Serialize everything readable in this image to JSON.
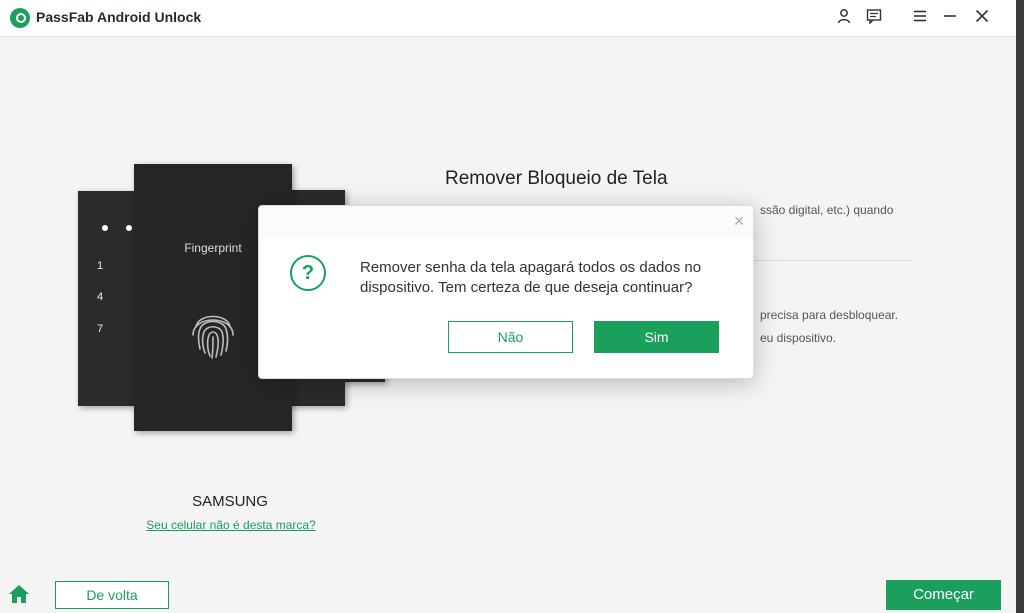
{
  "app": {
    "title": "PassFab Android Unlock"
  },
  "titlebar": {
    "icons": [
      "user-icon",
      "feedback-icon",
      "menu-icon",
      "minimize-icon",
      "close-icon"
    ]
  },
  "phone": {
    "fingerprint_label": "Fingerprint",
    "pin_numbers": [
      "1",
      "4",
      "7"
    ]
  },
  "brand": {
    "name": "SAMSUNG",
    "wrong_brand_link": "Seu celular não é desta marca?"
  },
  "section": {
    "title": "Remover Bloqueio de Tela",
    "desc1_visible": "ssão digital, etc.) quando",
    "desc2_visible": "precisa para desbloquear.",
    "desc3_visible": "eu dispositivo."
  },
  "bottom": {
    "back_label": "De volta",
    "start_label": "Começar"
  },
  "dialog": {
    "message": "Remover senha da tela apagará todos os dados no dispositivo. Tem certeza de que deseja continuar?",
    "question_glyph": "?",
    "close_glyph": "×",
    "no_label": "Não",
    "yes_label": "Sim"
  },
  "colors": {
    "accent": "#1a9f5c",
    "phone": "#2b2b2b"
  }
}
